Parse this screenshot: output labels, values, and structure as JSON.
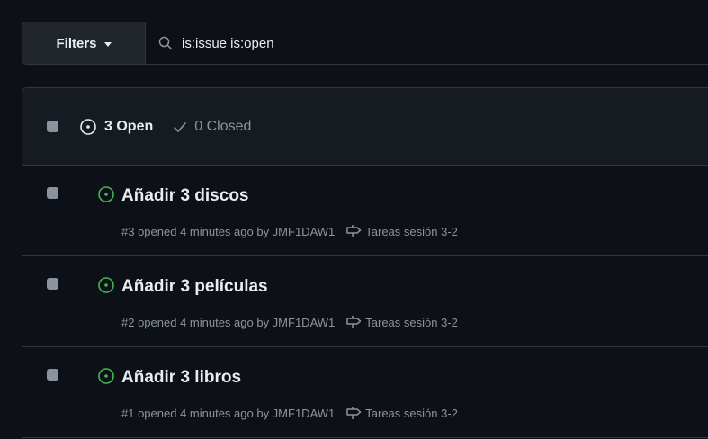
{
  "filter_bar": {
    "filters_label": "Filters",
    "search_value": "is:issue is:open"
  },
  "issues_header": {
    "open_label": "3 Open",
    "closed_label": "0 Closed"
  },
  "issues": [
    {
      "title": "Añadir 3 discos",
      "meta": "#3 opened 4 minutes ago by JMF1DAW1",
      "milestone": "Tareas sesión 3-2"
    },
    {
      "title": "Añadir 3 películas",
      "meta": "#2 opened 4 minutes ago by JMF1DAW1",
      "milestone": "Tareas sesión 3-2"
    },
    {
      "title": "Añadir 3 libros",
      "meta": "#1 opened 4 minutes ago by JMF1DAW1",
      "milestone": "Tareas sesión 3-2"
    }
  ],
  "colors": {
    "open_green": "#3fb950",
    "muted": "#8b949e",
    "border": "#30363d",
    "background": "#0d1117"
  }
}
